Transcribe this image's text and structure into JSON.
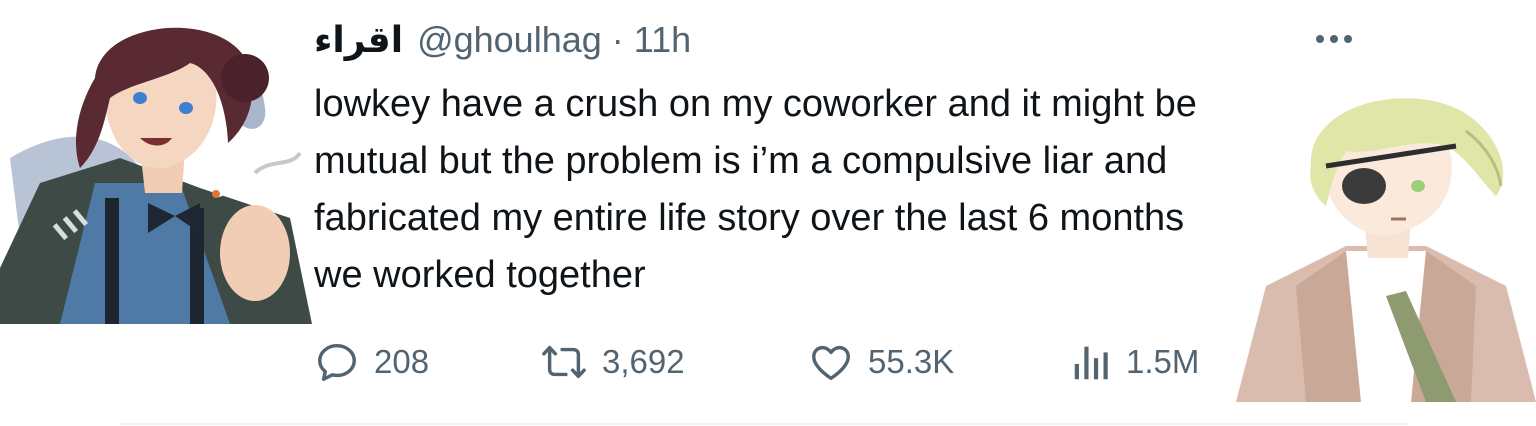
{
  "tweet": {
    "display_name": "اقراء",
    "handle": "@ghoulhag",
    "separator": "·",
    "time": "11h",
    "text": "lowkey have a crush on my coworker and it might be\nmutual but the problem is i’m a compulsive liar and\nfabricated my entire life story over the last 6 months\nwe worked together",
    "more_icon": "more-horizontal-icon"
  },
  "actions": {
    "reply": {
      "icon": "reply-icon",
      "count": "208"
    },
    "retweet": {
      "icon": "retweet-icon",
      "count": "3,692"
    },
    "like": {
      "icon": "heart-icon",
      "count": "55.3K"
    },
    "views": {
      "icon": "views-bar-chart-icon",
      "count": "1.5M"
    }
  },
  "colors": {
    "text": "#0f1419",
    "secondary": "#536471",
    "divider": "#eff3f4"
  }
}
